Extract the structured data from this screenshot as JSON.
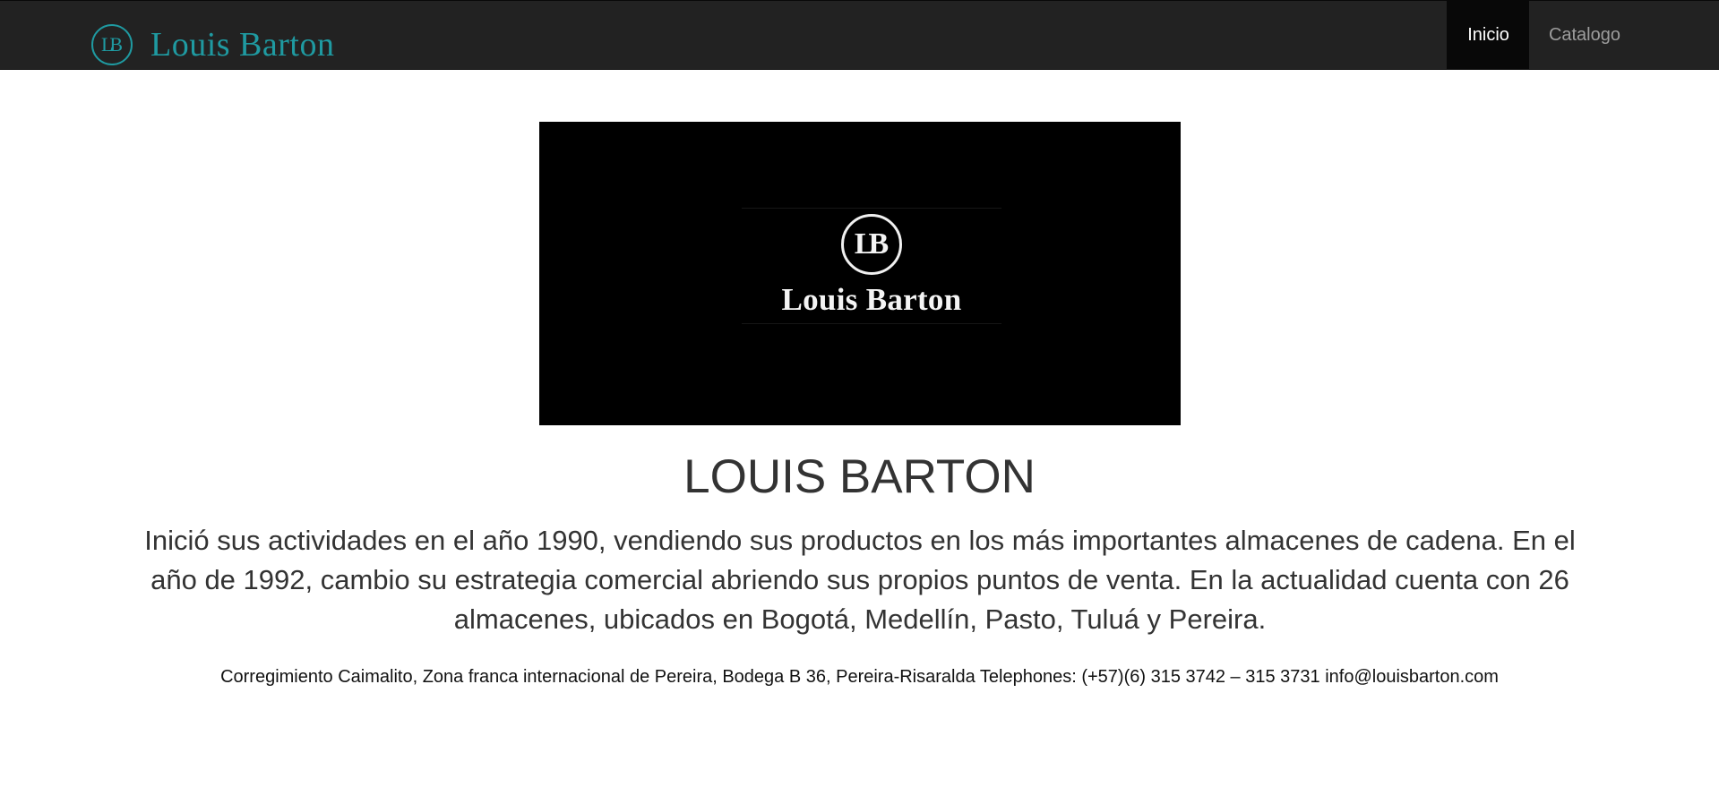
{
  "navbar": {
    "brand_monogram": "LB",
    "brand_name": "Louis Barton",
    "items": [
      {
        "label": "Inicio",
        "active": true
      },
      {
        "label": "Catalogo",
        "active": false
      }
    ],
    "accent_color": "#1f9aa1"
  },
  "hero": {
    "logo_monogram": "LB",
    "logo_text": "Louis Barton"
  },
  "main": {
    "title": "LOUIS BARTON",
    "description": "Inició sus actividades en el año 1990, vendiendo sus productos en los más importantes almacenes de cadena. En el año de 1992, cambio su estrategia comercial abriendo sus propios puntos de venta. En la actualidad cuenta con 26 almacenes, ubicados en Bogotá, Medellín, Pasto, Tuluá y Pereira."
  },
  "footer": {
    "contact": "Corregimiento Caimalito, Zona franca internacional de Pereira, Bodega B 36, Pereira-Risaralda Telephones: (+57)(6) 315 3742 – 315 3731 info@louisbarton.com"
  }
}
